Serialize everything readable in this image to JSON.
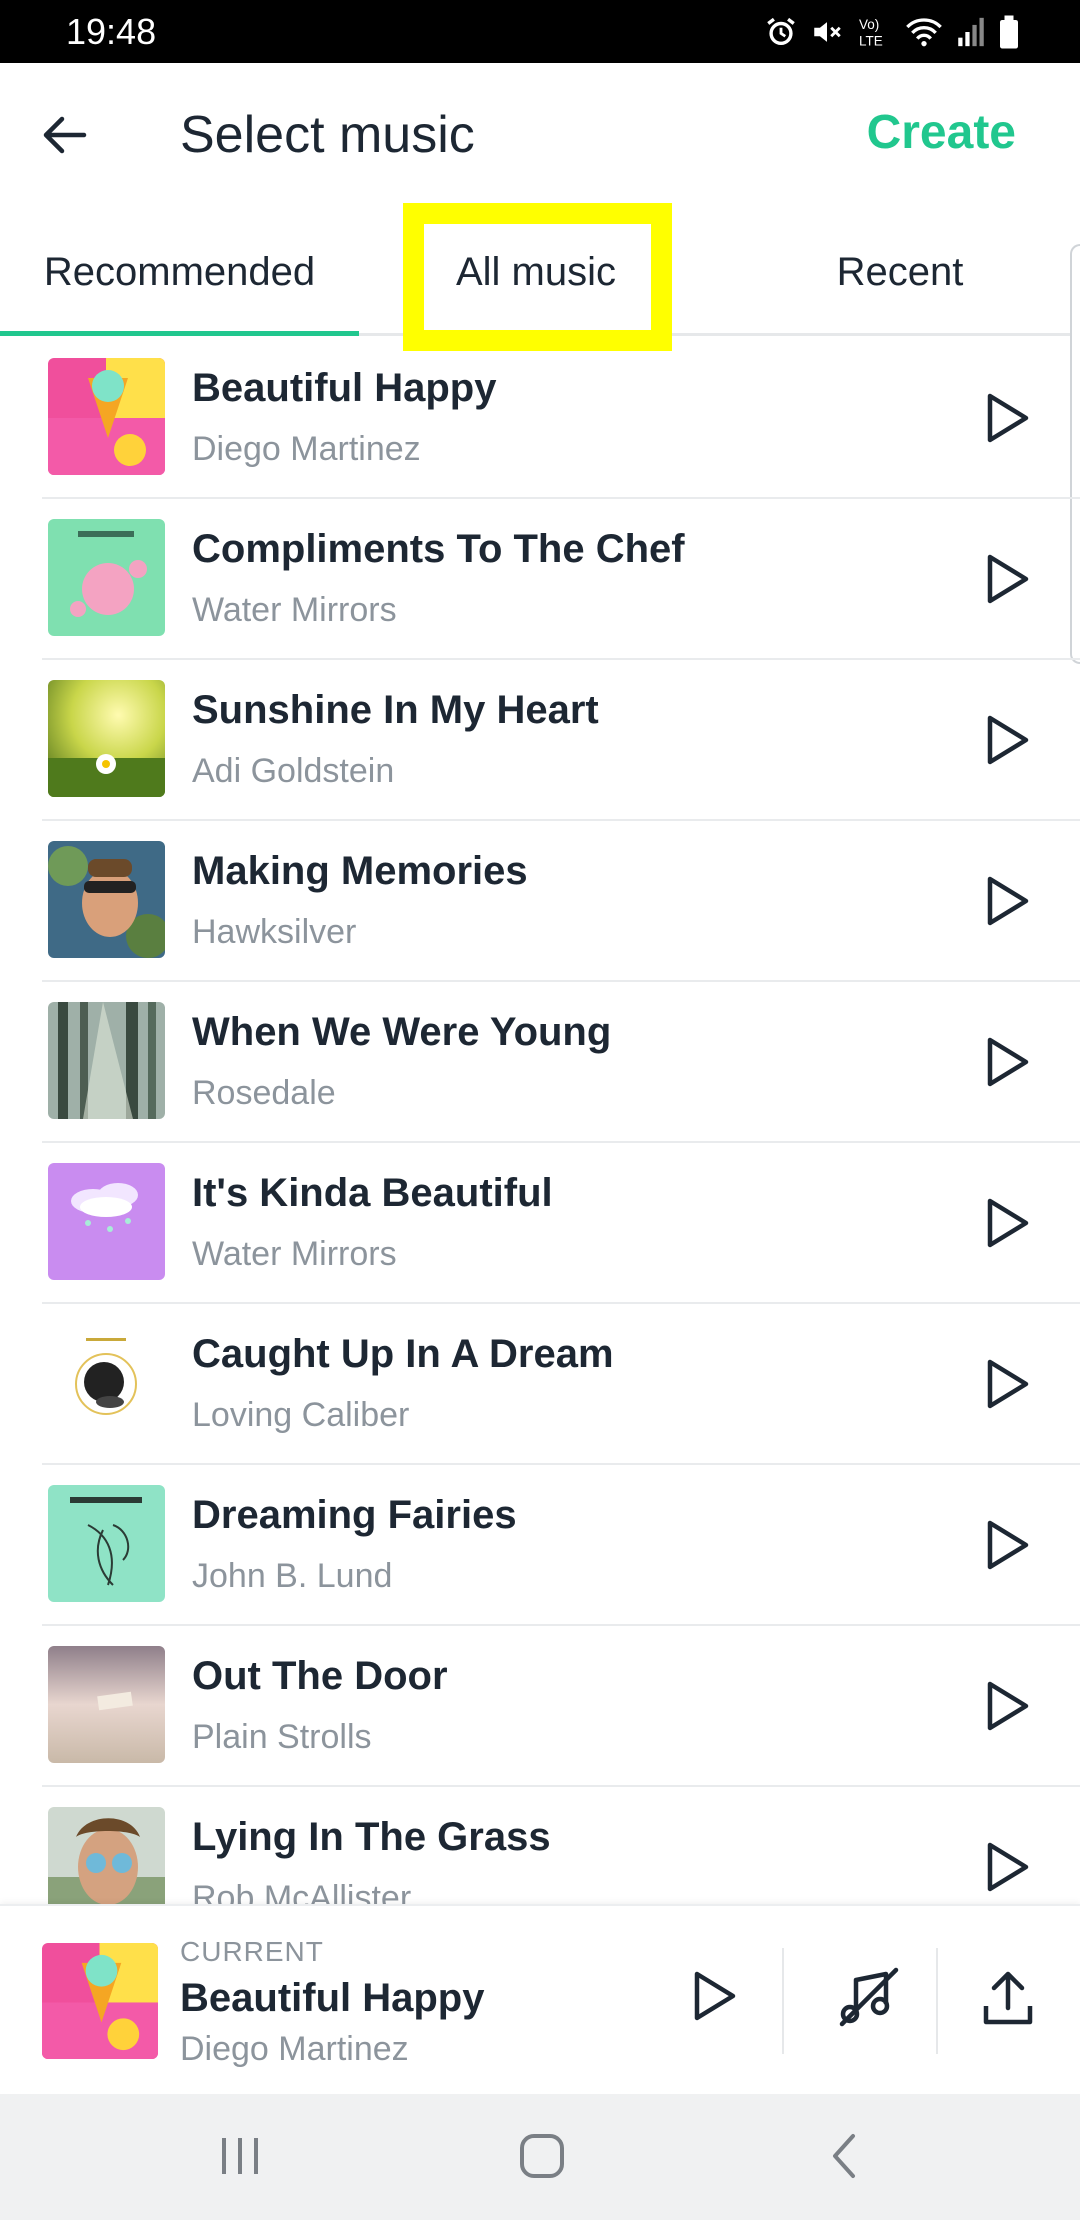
{
  "status_bar": {
    "time": "19:48"
  },
  "header": {
    "title": "Select music",
    "create_label": "Create"
  },
  "tabs": [
    {
      "label": "Recommended",
      "active": true
    },
    {
      "label": "All music",
      "active": false
    },
    {
      "label": "Recent",
      "active": false
    }
  ],
  "tracks": [
    {
      "title": "Beautiful Happy",
      "artist": "Diego Martinez"
    },
    {
      "title": "Compliments To The Chef",
      "artist": "Water Mirrors"
    },
    {
      "title": "Sunshine In My Heart",
      "artist": "Adi Goldstein"
    },
    {
      "title": "Making Memories",
      "artist": "Hawksilver"
    },
    {
      "title": "When We Were Young",
      "artist": "Rosedale"
    },
    {
      "title": "It's Kinda Beautiful",
      "artist": "Water Mirrors"
    },
    {
      "title": "Caught Up In A Dream",
      "artist": "Loving Caliber"
    },
    {
      "title": "Dreaming Fairies",
      "artist": "John B. Lund"
    },
    {
      "title": "Out The Door",
      "artist": "Plain Strolls"
    },
    {
      "title": "Lying In The Grass",
      "artist": "Rob McAllister"
    }
  ],
  "current": {
    "label": "CURRENT",
    "title": "Beautiful Happy",
    "artist": "Diego Martinez"
  },
  "colors": {
    "accent": "#21c78e",
    "highlight": "#ffff00",
    "text": "#1d2733",
    "muted": "#8c949c"
  }
}
